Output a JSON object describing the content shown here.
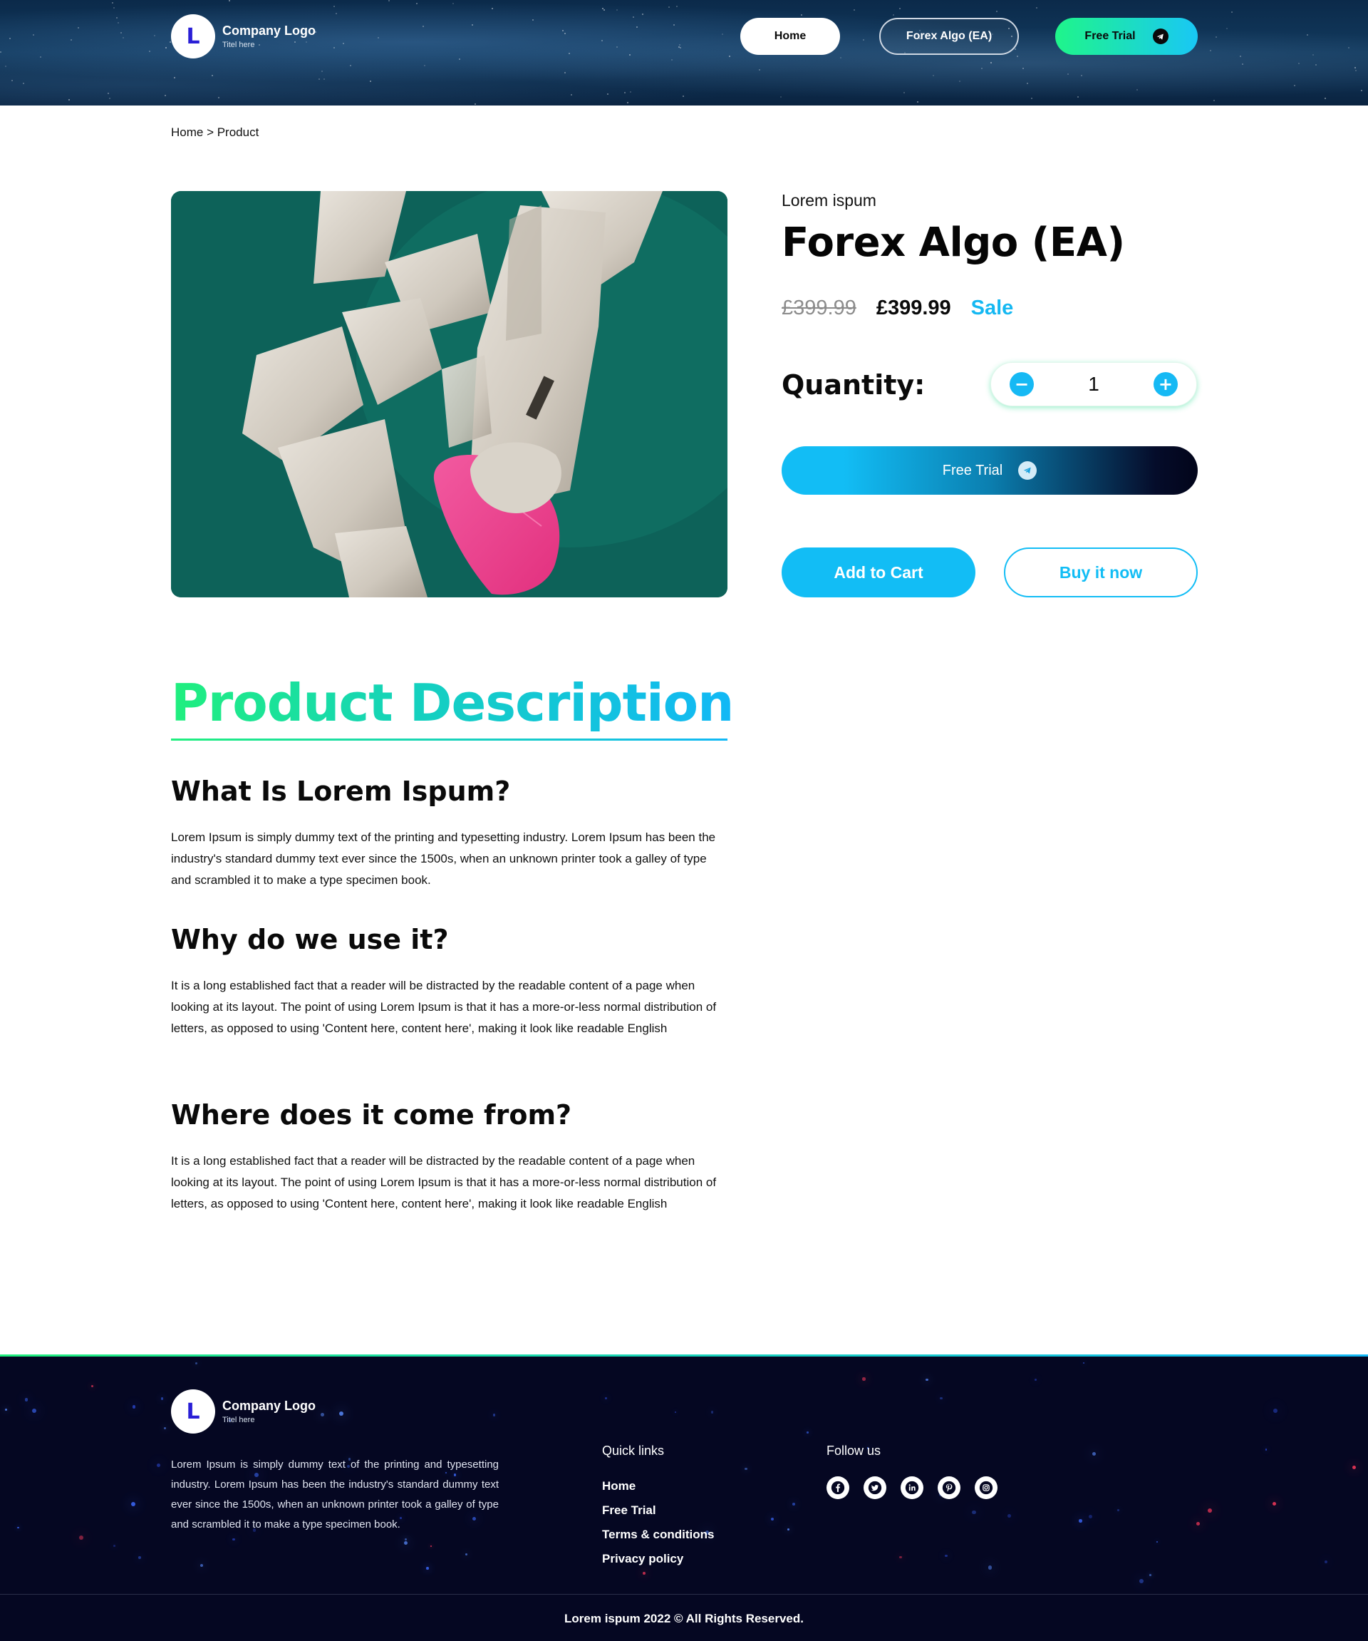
{
  "header": {
    "logo_letter": "L",
    "logo_title": "Company Logo",
    "logo_subtitle": "Titel here",
    "nav": {
      "home": "Home",
      "forex": "Forex Algo (EA)",
      "trial": "Free Trial"
    }
  },
  "breadcrumb": "Home > Product",
  "product": {
    "subtitle": "Lorem ispum",
    "title": "Forex Algo (EA)",
    "price_old": "£399.99",
    "price_new": "£399.99",
    "sale_label": "Sale",
    "quantity_label": "Quantity:",
    "quantity_value": "1",
    "minus_symbol": "−",
    "plus_symbol": "+",
    "trial_button": "Free Trial",
    "add_to_cart": "Add to Cart",
    "buy_now": "Buy it now"
  },
  "description": {
    "heading": "Product Description",
    "sections": [
      {
        "title": "What Is Lorem Ispum?",
        "body": "Lorem Ipsum is simply dummy text of the printing and typesetting industry. Lorem Ipsum has been the industry's standard dummy text ever since the 1500s, when an unknown printer took a galley of type and scrambled it to make a type specimen book."
      },
      {
        "title": "Why do we use it?",
        "body": "It is a long established fact that a reader will be distracted by the readable content of a page when looking at its layout. The point of using Lorem Ipsum is that it has a more-or-less normal distribution of letters, as opposed to using 'Content here, content here', making it look like readable English"
      },
      {
        "title": "Where does it come from?",
        "body": "It is a long established fact that a reader will be distracted by the readable content of a page when looking at its layout. The point of using Lorem Ipsum is that it has a more-or-less normal distribution of letters, as opposed to using 'Content here, content here', making it look like readable English"
      }
    ]
  },
  "footer": {
    "logo_letter": "L",
    "logo_title": "Company Logo",
    "logo_subtitle": "Titel here",
    "description": "Lorem Ipsum is simply dummy text of the printing and typesetting industry. Lorem Ipsum has been the industry's standard dummy text ever since the 1500s, when an unknown printer took a galley of type and scrambled it to make a type specimen book.",
    "quick_links_title": "Quick links",
    "quick_links": [
      "Home",
      "Free Trial",
      "Terms & conditions",
      "Privacy policy"
    ],
    "follow_title": "Follow us",
    "socials": [
      "facebook-icon",
      "twitter-icon",
      "linkedin-icon",
      "pinterest-icon",
      "instagram-icon"
    ],
    "copyright": "Lorem ispum 2022 © All Rights Reserved."
  },
  "colors": {
    "accent": "#12bdf5",
    "accent_green": "#20ef7e",
    "footer_bg": "#050722"
  }
}
